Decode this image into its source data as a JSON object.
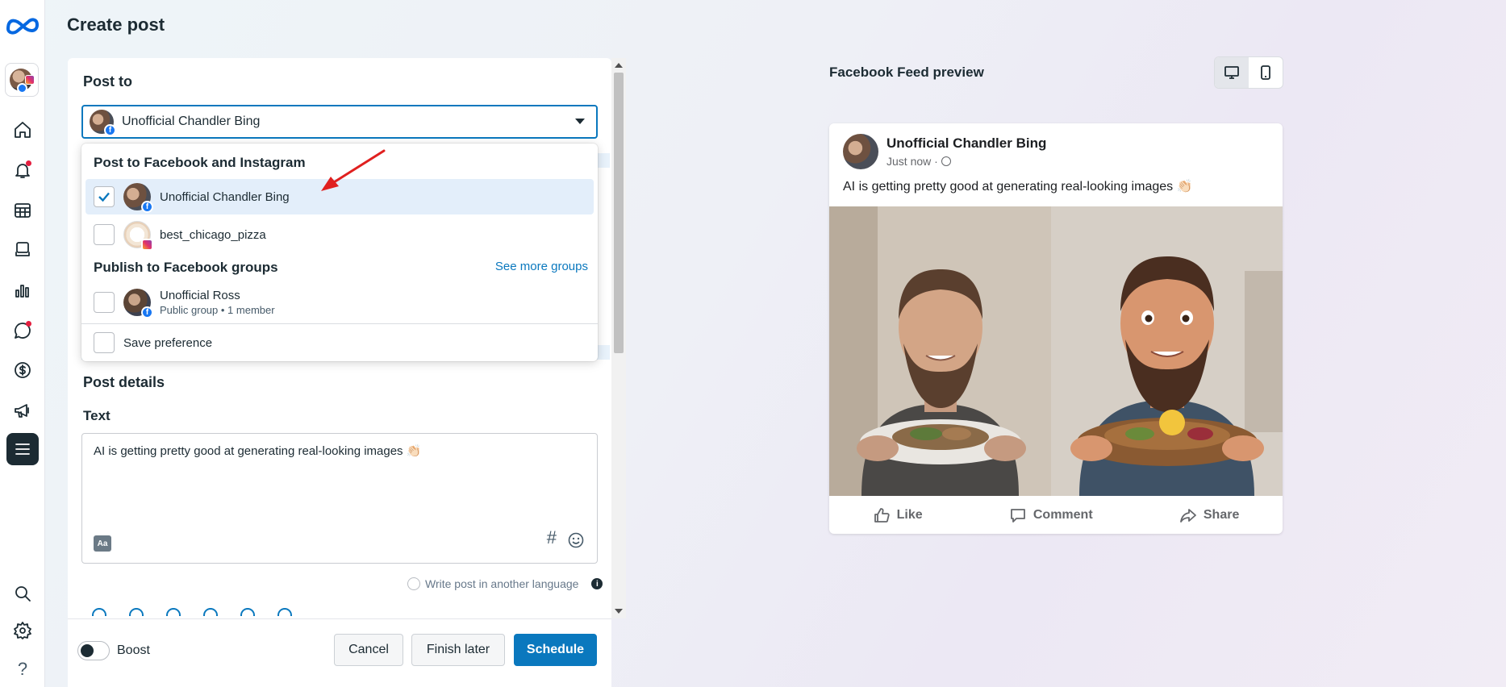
{
  "page": {
    "title": "Create post"
  },
  "nav": {
    "items": [
      {
        "name": "home",
        "icon": "home-icon"
      },
      {
        "name": "notifications",
        "icon": "bell-icon"
      },
      {
        "name": "content",
        "icon": "table-icon"
      },
      {
        "name": "pages",
        "icon": "stack-icon"
      },
      {
        "name": "insights",
        "icon": "bar-chart-icon"
      },
      {
        "name": "inbox",
        "icon": "chat-icon"
      },
      {
        "name": "monetization",
        "icon": "dollar-icon"
      },
      {
        "name": "ads",
        "icon": "megaphone-icon"
      },
      {
        "name": "all-tools",
        "icon": "menu-icon"
      },
      {
        "name": "search",
        "icon": "search-icon"
      },
      {
        "name": "settings",
        "icon": "gear-icon"
      },
      {
        "name": "help",
        "icon": "help-icon",
        "label": "?"
      }
    ]
  },
  "post_to": {
    "label": "Post to",
    "selected": "Unofficial Chandler Bing"
  },
  "dropdown": {
    "heading_accounts": "Post to Facebook and Instagram",
    "accounts": [
      {
        "label": "Unofficial Chandler Bing",
        "checked": true,
        "platform": "facebook"
      },
      {
        "label": "best_chicago_pizza",
        "checked": false,
        "platform": "instagram"
      }
    ],
    "heading_groups": "Publish to Facebook groups",
    "see_more": "See more groups",
    "groups": [
      {
        "label": "Unofficial Ross",
        "sub": "Public group • 1 member",
        "checked": false
      }
    ],
    "save_preference": "Save preference"
  },
  "post_details": {
    "label": "Post details",
    "text_label": "Text",
    "text_value": "AI is getting pretty good at generating real-looking images 👏🏻",
    "aa_label": "Aa",
    "hash_label": "#",
    "another_language": "Write post in another language",
    "info_label": "i"
  },
  "footer": {
    "boost_label": "Boost",
    "boost_on": false,
    "cancel": "Cancel",
    "finish_later": "Finish later",
    "schedule": "Schedule"
  },
  "preview": {
    "title": "Facebook Feed preview",
    "mode": "desktop",
    "name": "Unofficial Chandler Bing",
    "time": "Just now ·",
    "text": "AI is getting pretty good at generating real-looking images 👏🏻",
    "actions": {
      "like": "Like",
      "comment": "Comment",
      "share": "Share"
    }
  },
  "colors": {
    "accent": "#0a78be",
    "selected_row": "#e3eefa",
    "annotation_arrow": "#e0201f"
  }
}
